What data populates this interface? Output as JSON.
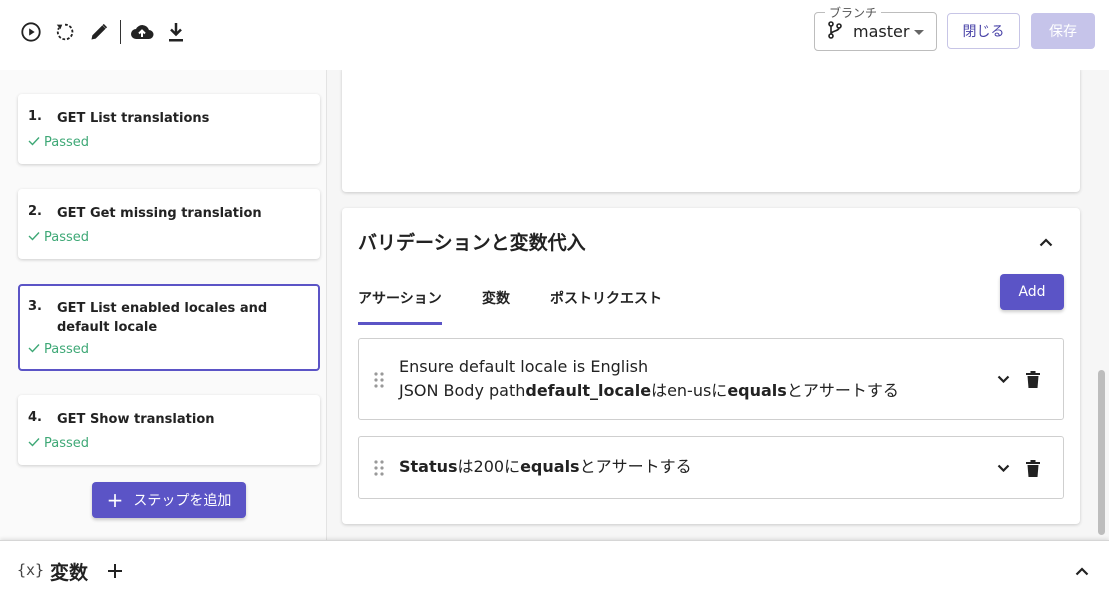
{
  "toolbar": {
    "icons": [
      "play-circle-icon",
      "restore-icon",
      "pencil-icon",
      "cloud-upload-icon",
      "download-icon"
    ],
    "branch_label": "ブランチ",
    "branch_value": "master",
    "close_label": "閉じる",
    "save_label": "保存"
  },
  "steps": [
    {
      "num": "1.",
      "title": "GET List translations",
      "status": "Passed"
    },
    {
      "num": "2.",
      "title": "GET Get missing translation",
      "status": "Passed"
    },
    {
      "num": "3.",
      "title": "GET List enabled locales and default locale",
      "status": "Passed"
    },
    {
      "num": "4.",
      "title": "GET Show translation",
      "status": "Passed"
    }
  ],
  "add_step_label": "ステップを追加",
  "validation": {
    "title": "バリデーションと変数代入",
    "tabs": [
      "アサーション",
      "変数",
      "ポストリクエスト"
    ],
    "active_tab": "アサーション",
    "add_label": "Add",
    "assertions": [
      {
        "name": "Ensure default locale is English",
        "parts": [
          {
            "text": "JSON Body path",
            "bold": false
          },
          {
            "text": "default_locale",
            "bold": true
          },
          {
            "text": "はen-usに",
            "bold": false
          },
          {
            "text": "equals",
            "bold": true
          },
          {
            "text": "とアサートする",
            "bold": false
          }
        ]
      },
      {
        "name": "",
        "parts": [
          {
            "text": "Status",
            "bold": true
          },
          {
            "text": "は200に",
            "bold": false
          },
          {
            "text": "equals",
            "bold": true
          },
          {
            "text": "とアサートする",
            "bold": false
          }
        ]
      }
    ]
  },
  "variables": {
    "icon_text": "{x}",
    "title": "変数"
  },
  "colors": {
    "accent": "#5b54c6",
    "passed": "#3ea876",
    "save_disabled": "#c6c4ea"
  }
}
